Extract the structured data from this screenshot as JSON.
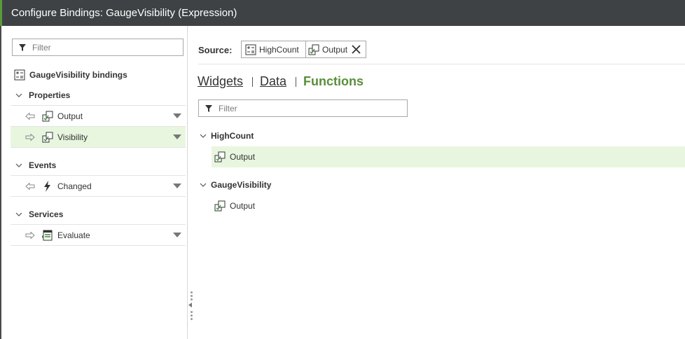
{
  "window": {
    "title": "Configure Bindings: GaugeVisibility (Expression)"
  },
  "left": {
    "filter_placeholder": "Filter",
    "root_label": "GaugeVisibility bindings",
    "sections": {
      "properties": {
        "label": "Properties",
        "items": [
          {
            "label": "Output",
            "direction": "in"
          },
          {
            "label": "Visibility",
            "direction": "out",
            "selected": true
          }
        ]
      },
      "events": {
        "label": "Events",
        "items": [
          {
            "label": "Changed",
            "direction": "in"
          }
        ]
      },
      "services": {
        "label": "Services",
        "items": [
          {
            "label": "Evaluate",
            "direction": "out"
          }
        ]
      }
    }
  },
  "right": {
    "source_label": "Source:",
    "source_chips": [
      "HighCount",
      "Output"
    ],
    "tabs": [
      "Widgets",
      "Data",
      "Functions"
    ],
    "active_tab": "Functions",
    "filter_placeholder": "Filter",
    "tree": [
      {
        "label": "HighCount",
        "children": [
          {
            "label": "Output",
            "selected": true
          }
        ]
      },
      {
        "label": "GaugeVisibility",
        "children": [
          {
            "label": "Output",
            "selected": false
          }
        ]
      }
    ]
  },
  "colors": {
    "title_bg": "#3e4245",
    "accent": "#5a8e3a",
    "selected_bg": "#e8f6df"
  }
}
